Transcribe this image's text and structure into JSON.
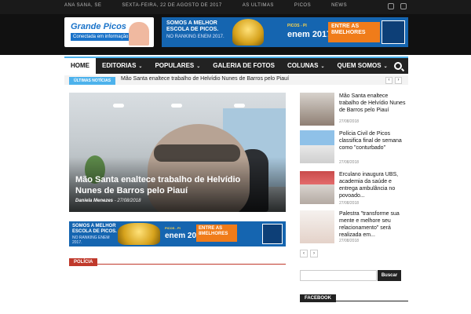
{
  "topbar": {
    "links": [
      "ANA SANA, SE",
      "SEXTA-FEIRA, 22 DE AGOSTO DE 2017",
      "AS ULTIMAS",
      "PICOS",
      "NEWS"
    ],
    "icons": [
      "facebook-icon",
      "youtube-icon"
    ]
  },
  "header": {
    "logo_text": "Grande Picos",
    "logo_sub": "Conectada em informação",
    "banner": {
      "line1": "SOMOS A MELHOR ESCOLA DE PICOS.",
      "line2": "NO RANKING ENEM 2017.",
      "enem": "enem",
      "year": "2017",
      "region": "PICOS - PI",
      "orange": "ENTRE AS 8MELHORES",
      "phone": "3422-1506"
    }
  },
  "nav": {
    "items": [
      {
        "label": "HOME",
        "has_menu": false,
        "active": true
      },
      {
        "label": "EDITORIAS",
        "has_menu": true,
        "active": false
      },
      {
        "label": "POPULARES",
        "has_menu": true,
        "active": false
      },
      {
        "label": "GALERIA DE FOTOS",
        "has_menu": false,
        "active": false
      },
      {
        "label": "COLUNAS",
        "has_menu": true,
        "active": false
      },
      {
        "label": "QUEM SOMOS",
        "has_menu": true,
        "active": false
      }
    ],
    "chevron": "⌄"
  },
  "ticker": {
    "label": "ÚLTIMAS NOTÍCIAS",
    "text": "Mão Santa enaltece trabalho de Helvídio Nunes de Barros pelo Piauí",
    "prev": "‹",
    "next": "›"
  },
  "feature": {
    "title": "Mão Santa enaltece trabalho de Helvídio Nunes de Barros pelo Piauí",
    "author": "Daniela Menezes",
    "date": "27/08/2018"
  },
  "mid_banner": {
    "line1": "SOMOS A MELHOR ESCOLA DE PICOS.",
    "line2": "NO RANKING ENEM 2017.",
    "enem": "enem",
    "year": "2017",
    "region": "PICOS - PI",
    "orange": "ENTRE AS 8MELHORES"
  },
  "section": {
    "label": "POLÍCIA"
  },
  "sidebar": {
    "items": [
      {
        "title": "Mão Santa enaltece trabalho de Helvídio Nunes de Barros pelo Piauí",
        "date": "27/08/2018"
      },
      {
        "title": "Polícia Civil de Picos classifica final de semana como \"conturbado\"",
        "date": "27/08/2018"
      },
      {
        "title": "Erculano inaugura UBS, academia da saúde e entrega ambulância no povoado...",
        "date": "27/08/2018"
      },
      {
        "title": "Palestra \"transforme sua mente e melhore seu relacionamento\" será realizada em...",
        "date": "27/08/2018"
      }
    ],
    "prev": "‹",
    "next": "›",
    "search_placeholder": "",
    "search_button": "Buscar",
    "facebook_label": "FACEBOOK"
  },
  "colors": {
    "accent": "#4db2ec",
    "section_red": "#c0392b",
    "banner_blue": "#1565b0",
    "banner_orange": "#f07c1a"
  }
}
